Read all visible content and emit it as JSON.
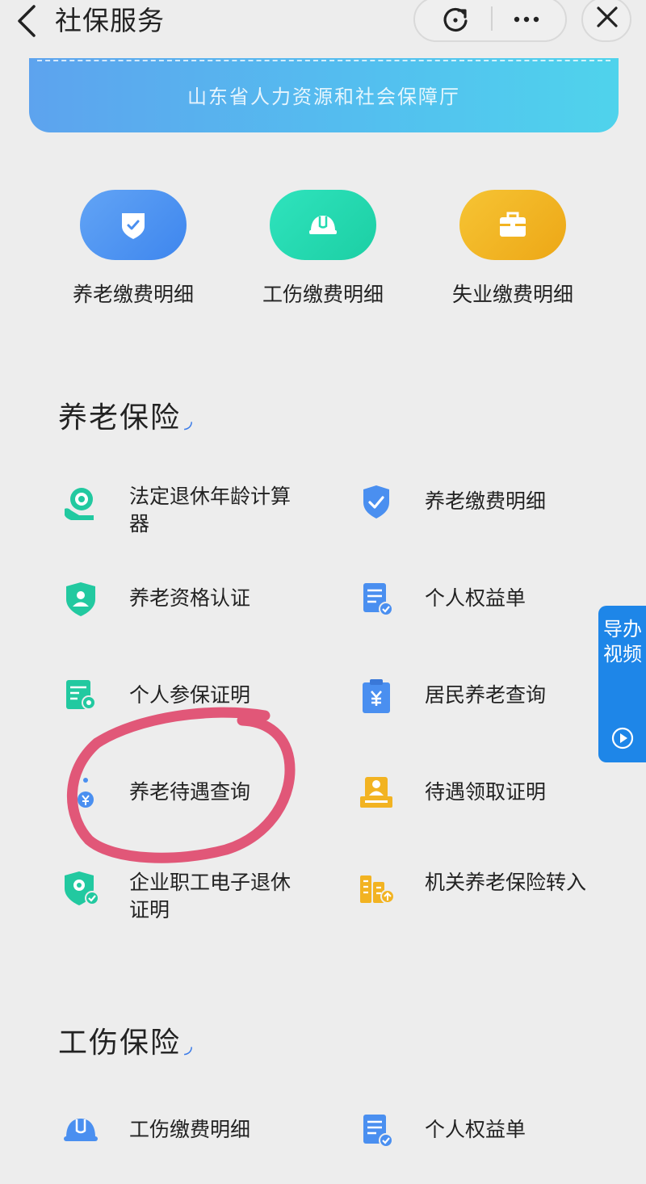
{
  "header": {
    "title": "社保服务"
  },
  "banner": {
    "text": "山东省人力资源和社会保障厅"
  },
  "quick_actions": [
    {
      "label": "养老缴费明细",
      "icon": "shield-check-icon",
      "color": "#4a8ff0"
    },
    {
      "label": "工伤缴费明细",
      "icon": "hard-hat-icon",
      "color": "#22dbb0"
    },
    {
      "label": "失业缴费明细",
      "icon": "briefcase-icon",
      "color": "#f2b322"
    }
  ],
  "sections": [
    {
      "title": "养老保险",
      "items": [
        {
          "label": "法定退休年龄计算器",
          "icon": "retirement-calculator-icon"
        },
        {
          "label": "养老缴费明细",
          "icon": "shield-check-icon"
        },
        {
          "label": "养老资格认证",
          "icon": "person-shield-icon"
        },
        {
          "label": "个人权益单",
          "icon": "document-check-icon"
        },
        {
          "label": "个人参保证明",
          "icon": "certificate-icon"
        },
        {
          "label": "居民养老查询",
          "icon": "clipboard-yuan-icon"
        },
        {
          "label": "养老待遇查询",
          "icon": "yuan-coin-icon"
        },
        {
          "label": "待遇领取证明",
          "icon": "person-card-icon"
        },
        {
          "label": "企业职工电子退休证明",
          "icon": "retirement-certificate-icon"
        },
        {
          "label": "机关养老保险转入",
          "icon": "building-transfer-icon"
        }
      ]
    },
    {
      "title": "工伤保险",
      "items": [
        {
          "label": "工伤缴费明细",
          "icon": "hard-hat-icon"
        },
        {
          "label": "个人权益单",
          "icon": "document-check-icon"
        }
      ]
    }
  ],
  "float_tab": {
    "label": "导办视频",
    "icon": "play-icon"
  },
  "colors": {
    "accent": "#1e86e8",
    "annotation": "#e04a6e",
    "green": "#22c9a0",
    "blue": "#4a8ff0",
    "gold": "#f2b322"
  }
}
